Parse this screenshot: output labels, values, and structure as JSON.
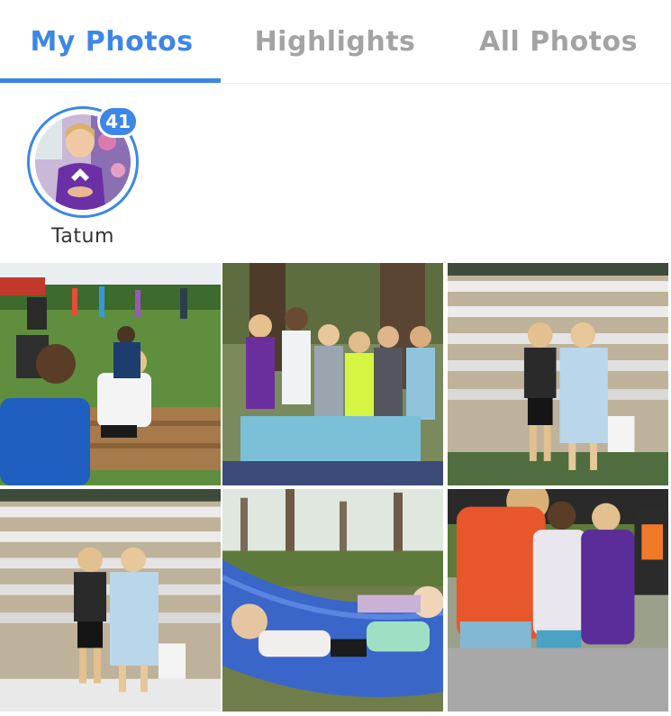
{
  "tabs": [
    {
      "label": "My Photos",
      "active": true
    },
    {
      "label": "Highlights",
      "active": false
    },
    {
      "label": "All Photos",
      "active": false
    }
  ],
  "colors": {
    "accent": "#3d86e8",
    "inactive_tab": "#a3a3a3"
  },
  "people": [
    {
      "name": "Tatum",
      "photo_count": "41"
    }
  ],
  "photos": [
    {
      "subject": "boys-field-game"
    },
    {
      "subject": "girls-group-under-tree"
    },
    {
      "subject": "two-girls-bleachers"
    },
    {
      "subject": "two-girls-bleachers-duplicate"
    },
    {
      "subject": "girls-in-hammock"
    },
    {
      "subject": "counselor-with-girls"
    }
  ]
}
